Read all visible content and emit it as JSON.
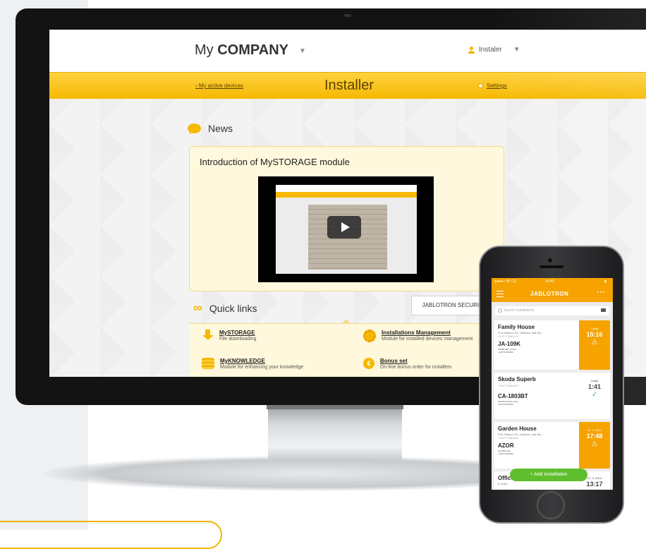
{
  "desktop": {
    "company": {
      "prefix": "My",
      "name": "COMPANY"
    },
    "user_label": "Instaler",
    "nav": {
      "left_link": "My active devices",
      "title": "Installer",
      "right_link": "Settings"
    },
    "news": {
      "heading": "News",
      "article_title": "Introduction of MySTORAGE module"
    },
    "quick_links": {
      "heading": "Quick links",
      "dropdown_value": "JABLOTRON SECURITY",
      "items": [
        {
          "title": "MySTORAGE",
          "subtitle": "File downloading",
          "icon": "download-icon"
        },
        {
          "title": "MyKNOWLEDGE",
          "subtitle": "Module for enhancing your knowledge",
          "icon": "books-icon"
        },
        {
          "title": "Installations Management",
          "subtitle": "Module for installed devices management",
          "icon": "gear-icon"
        },
        {
          "title": "Bonus set",
          "subtitle": "On-line bonus order for installers",
          "icon": "coin-icon"
        }
      ]
    }
  },
  "mobile": {
    "status": {
      "carrier": "●●●●○ VF CZ",
      "time": "15:43"
    },
    "app_title": "JABLOTRON",
    "more": "• • •",
    "search_placeholder": "Search installations",
    "installations": [
      {
        "name": "Family House",
        "address": "Pod Skalnou 33, Jablonec nad Nis...",
        "phone": "+420773481622",
        "model": "JA-109K",
        "serial": "ZH4BF-9B7-LOK3Y",
        "serial2": "+420774436456",
        "date": "Today",
        "time": "15:16",
        "status": "⚠",
        "state": "warning"
      },
      {
        "name": "Skoda Superb",
        "address": "",
        "phone": "+420773481622",
        "model": "CA-1803BT",
        "serial": "CBYPD-KRJ47-CCAI",
        "serial2": "+420774436456",
        "date": "Today",
        "time": "1:41",
        "status": "✓",
        "state": "ok"
      },
      {
        "name": "Garden House",
        "address": "Pod Skalnou 33, Jablonec nad Nis...",
        "phone": "+420773481622",
        "model": "AZOR",
        "serial": "AIA-8403-KE",
        "serial2": "+420774436456",
        "date": "21. 3. 2014",
        "time": "17:48",
        "status": "⚠",
        "state": "warning"
      },
      {
        "name": "Office",
        "address": "K Dubu...",
        "phone": "",
        "model": "",
        "serial": "",
        "serial2": "",
        "date": "21. 3. 2014",
        "time": "13:17",
        "status": "",
        "state": "ok"
      }
    ],
    "fab_label": "+ Add installation"
  },
  "colors": {
    "accent": "#f6b800",
    "accent_dark": "#f6a300",
    "fab_green": "#5fbe2c"
  }
}
